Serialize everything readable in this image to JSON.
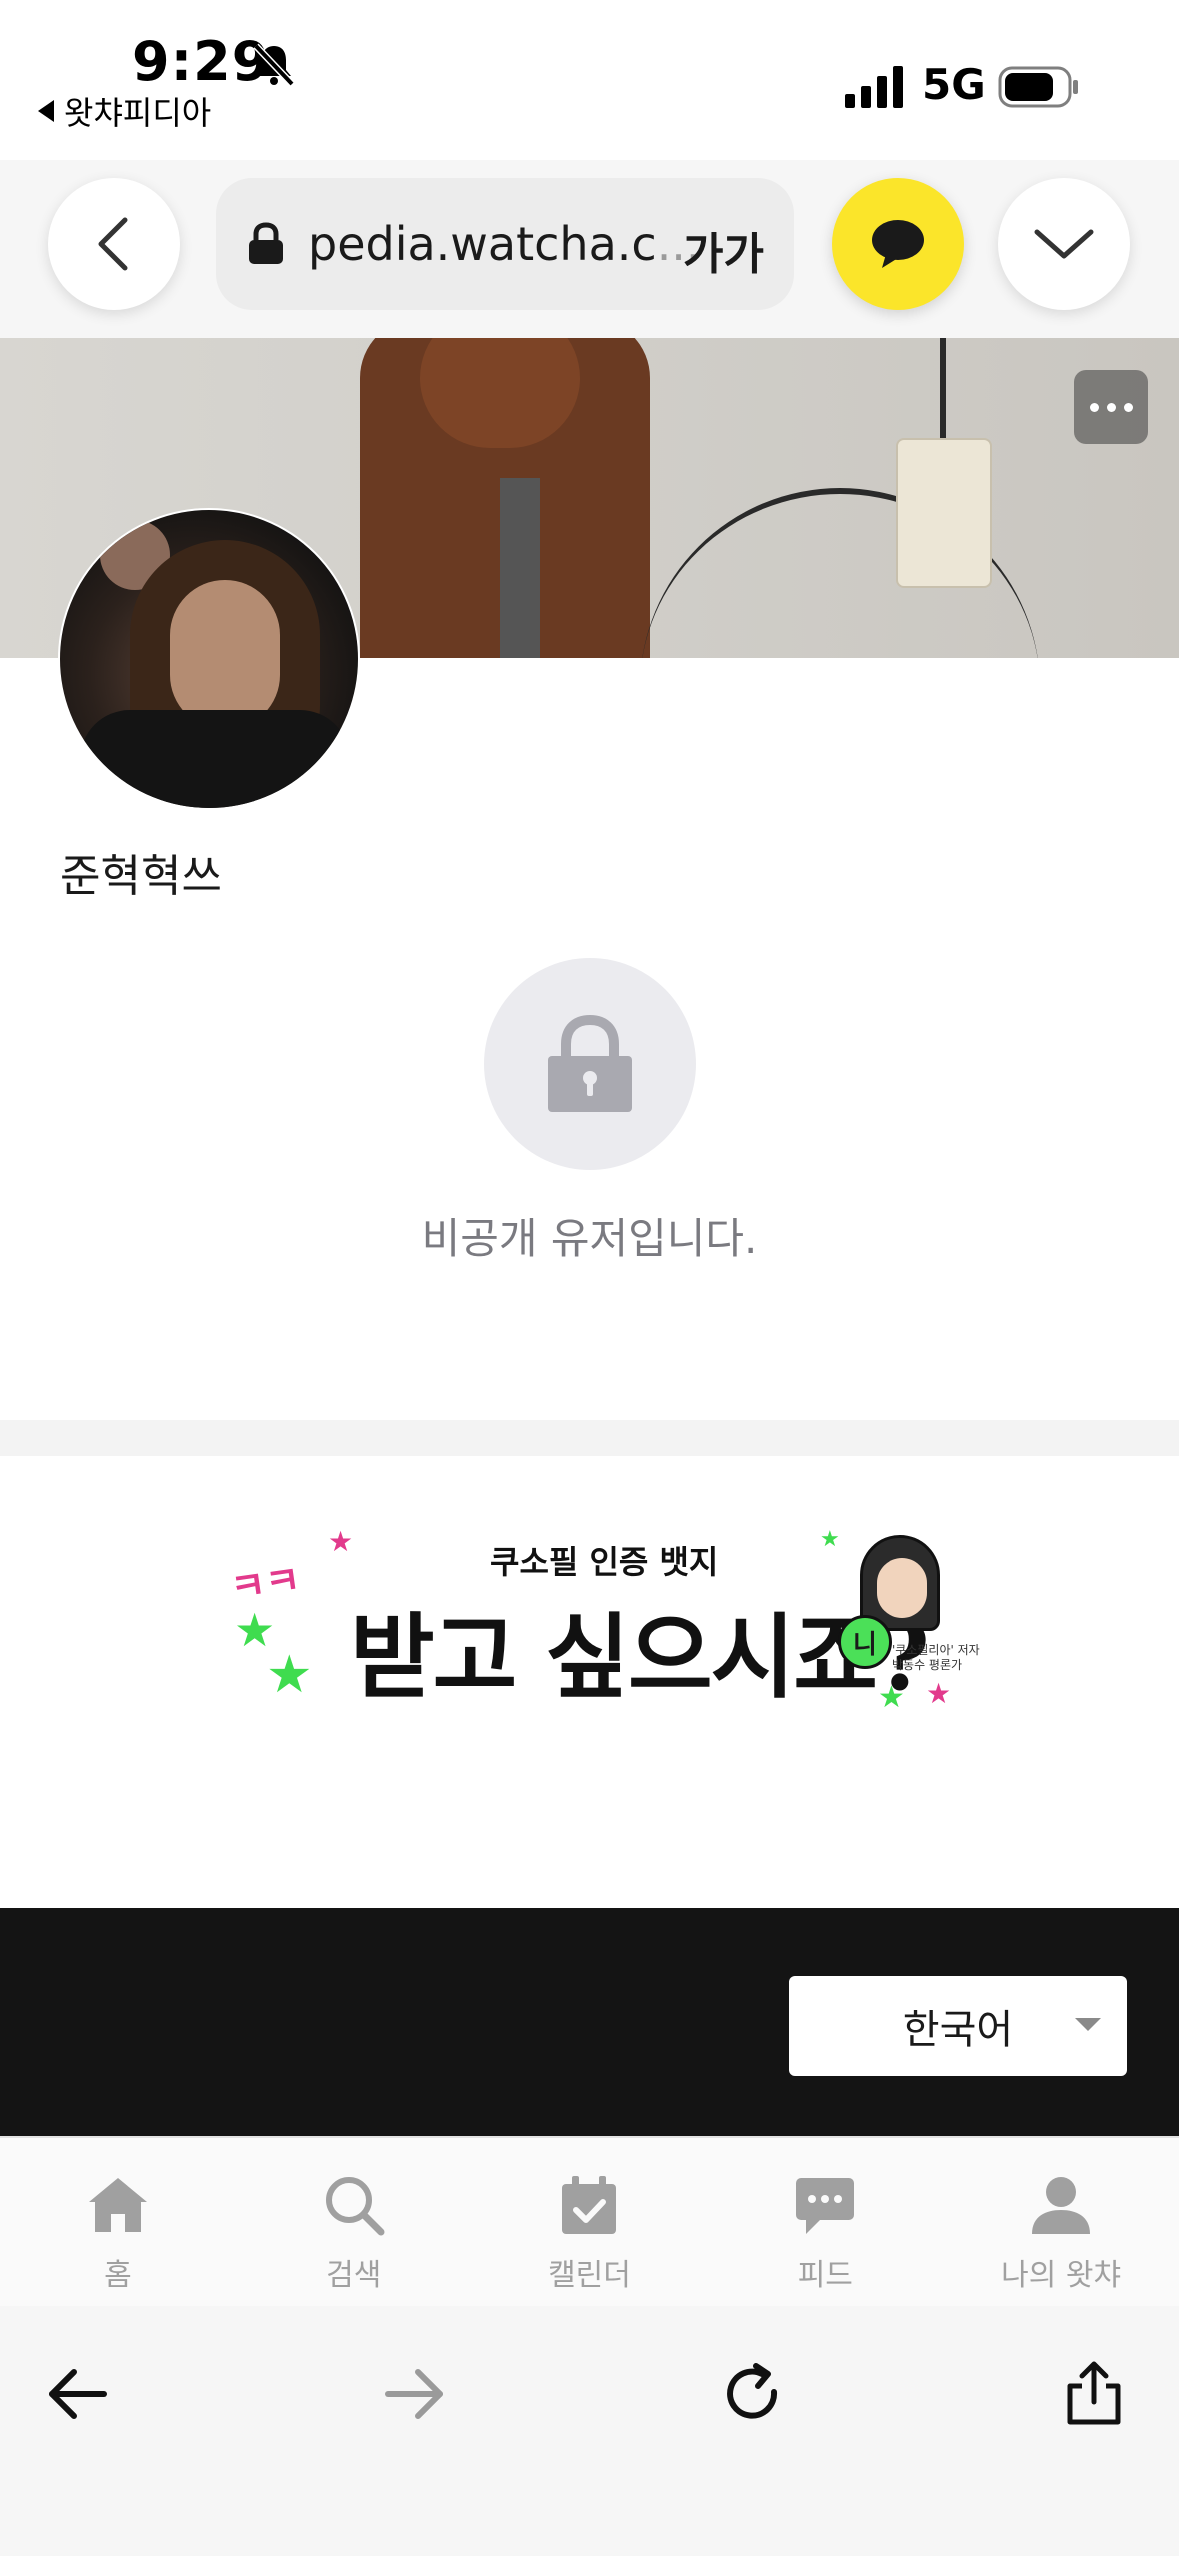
{
  "status_bar": {
    "time": "9:29",
    "back_app_label": "왓챠피디아",
    "network": "5G"
  },
  "browser": {
    "url": "pedia.watcha.c",
    "url_ellipsis": "...",
    "text_size_label": "가가"
  },
  "profile": {
    "username": "준혁혁쓰",
    "private_message": "비공개 유저입니다."
  },
  "banner": {
    "subtitle": "쿠소필 인증 뱃지",
    "title": "받고 싶으시죠?",
    "decoration": "ㅋㅋ",
    "badge_letter": "니",
    "caption_line1": "'쿠소필리아' 저자",
    "caption_line2": "박동수 평론가"
  },
  "footer": {
    "language": "한국어"
  },
  "tab_bar": {
    "items": [
      {
        "label": "홈",
        "icon": "home-icon"
      },
      {
        "label": "검색",
        "icon": "search-icon"
      },
      {
        "label": "캘린더",
        "icon": "calendar-icon"
      },
      {
        "label": "피드",
        "icon": "feed-icon"
      },
      {
        "label": "나의 왓챠",
        "icon": "profile-icon"
      }
    ]
  },
  "colors": {
    "chat_button": "#fbe52a",
    "footer_bg": "#141414",
    "tab_inactive": "#a0a0a0"
  }
}
